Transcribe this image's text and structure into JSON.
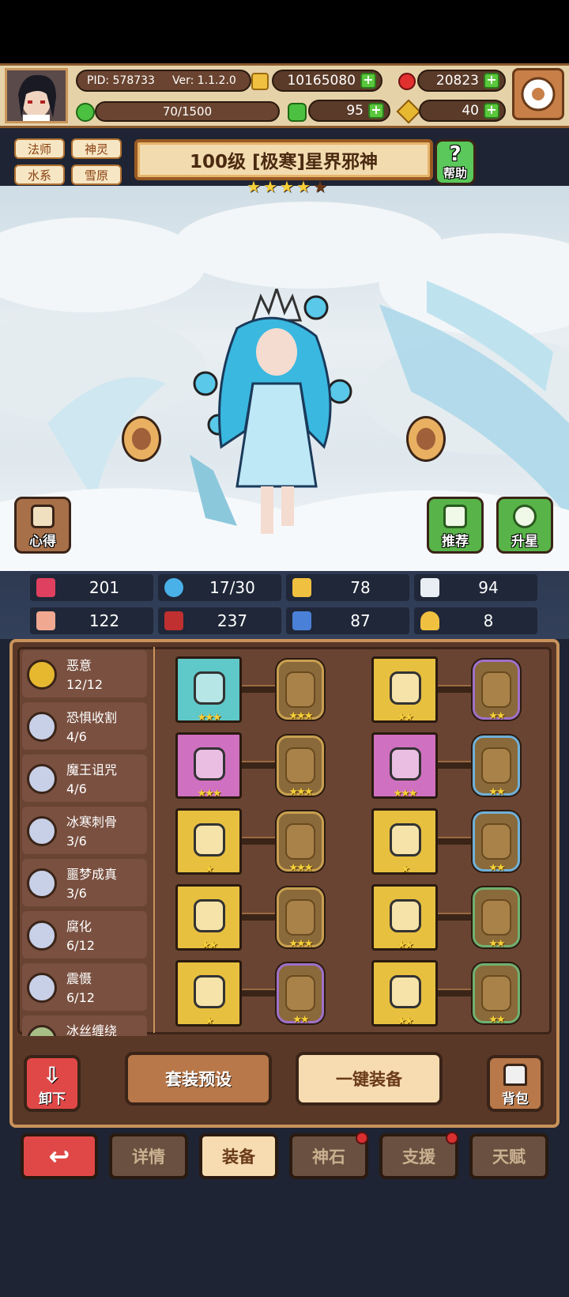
{
  "player": {
    "pid": "PID: 578733",
    "version": "Ver: 1.1.2.0",
    "stamina": "70/1500"
  },
  "currency": {
    "gold": "10165080",
    "gems": "20823",
    "clover": "95",
    "key": "40"
  },
  "tags": [
    "法师",
    "神灵",
    "水系",
    "雪原"
  ],
  "hero": {
    "title": "100级 [极寒]星界邪神",
    "stars_filled": 4,
    "stars_total": 5
  },
  "buttons": {
    "help": "帮助",
    "insight": "心得",
    "recommend": "推荐",
    "star_up": "升星"
  },
  "stats": [
    {
      "icon": "heart-icon",
      "value": "201"
    },
    {
      "icon": "mana-drop-icon",
      "value": "17/30"
    },
    {
      "icon": "shield-icon",
      "value": "78"
    },
    {
      "icon": "wing-icon",
      "value": "94"
    },
    {
      "icon": "fist-icon",
      "value": "122"
    },
    {
      "icon": "spellbook-icon",
      "value": "237"
    },
    {
      "icon": "magic-defense-icon",
      "value": "87"
    },
    {
      "icon": "horseshoe-icon",
      "value": "8"
    }
  ],
  "sets": [
    {
      "name": "恶意",
      "count": "12/12",
      "color": "#e6b830"
    },
    {
      "name": "恐惧收割",
      "count": "4/6",
      "color": "#c8d0e8"
    },
    {
      "name": "魔王诅咒",
      "count": "4/6",
      "color": "#c8d0e8"
    },
    {
      "name": "冰寒刺骨",
      "count": "3/6",
      "color": "#c8d0e8"
    },
    {
      "name": "噩梦成真",
      "count": "3/6",
      "color": "#c8d0e8"
    },
    {
      "name": "腐化",
      "count": "6/12",
      "color": "#c8d0e8"
    },
    {
      "name": "震慑",
      "count": "6/12",
      "color": "#c8d0e8"
    },
    {
      "name": "冰丝缠绕",
      "count": "",
      "color": "#a8c088"
    }
  ],
  "equipment": [
    {
      "name": "staff",
      "bg": "#5fc8c8",
      "stars": "★★★",
      "gem_border": "#c8a050",
      "gem_stars": "★★★"
    },
    {
      "name": "hood",
      "bg": "#e8c040",
      "stars": "★★",
      "gem_border": "#a070c8",
      "gem_stars": "★★"
    },
    {
      "name": "amulet",
      "bg": "#d070c0",
      "stars": "★★★",
      "gem_border": "#c8a050",
      "gem_stars": "★★★"
    },
    {
      "name": "robe",
      "bg": "#d070c0",
      "stars": "★★★",
      "gem_border": "#70b0d8",
      "gem_stars": "★★"
    },
    {
      "name": "necklace",
      "bg": "#e8c040",
      "stars": "★",
      "gem_border": "#c8a050",
      "gem_stars": "★★★"
    },
    {
      "name": "gauntlet",
      "bg": "#e8c040",
      "stars": "★",
      "gem_border": "#70b0d8",
      "gem_stars": "★★"
    },
    {
      "name": "ring",
      "bg": "#e8c040",
      "stars": "★★",
      "gem_border": "#c8a050",
      "gem_stars": "★★★"
    },
    {
      "name": "shoulder",
      "bg": "#e8c040",
      "stars": "★★",
      "gem_border": "#70b070",
      "gem_stars": "★★"
    },
    {
      "name": "helmet",
      "bg": "#e8c040",
      "stars": "★",
      "gem_border": "#a070c8",
      "gem_stars": "★★"
    },
    {
      "name": "boots",
      "bg": "#e8c040",
      "stars": "★★",
      "gem_border": "#70b070",
      "gem_stars": "★★"
    }
  ],
  "actions": {
    "unequip": "卸下",
    "preset": "套装预设",
    "auto_equip": "一键装备",
    "bag": "背包"
  },
  "tabs": [
    "详情",
    "装备",
    "神石",
    "支援",
    "天赋"
  ]
}
